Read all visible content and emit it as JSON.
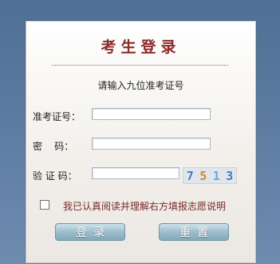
{
  "form": {
    "title": "考生登录",
    "hint": "请输入九位准考证号",
    "exam_id_label": "准考证号：",
    "password_label": "密    码：",
    "captcha_label": "验 证 码：",
    "exam_id_value": "",
    "password_value": "",
    "captcha_value": "",
    "captcha_text": [
      "7",
      "5",
      "1",
      "3"
    ],
    "captcha_colors": [
      "#4a78b8",
      "#d28a2a",
      "#6aa6d6",
      "#4a78b8"
    ],
    "agree_text": "我已认真阅读并理解右方填报志愿说明",
    "agree_checked": false,
    "login_button": "登录",
    "reset_button": "重置"
  },
  "colors": {
    "title": "#8c2a2a",
    "agree_text": "#7a2a2a",
    "button": "#9dbdcb"
  }
}
